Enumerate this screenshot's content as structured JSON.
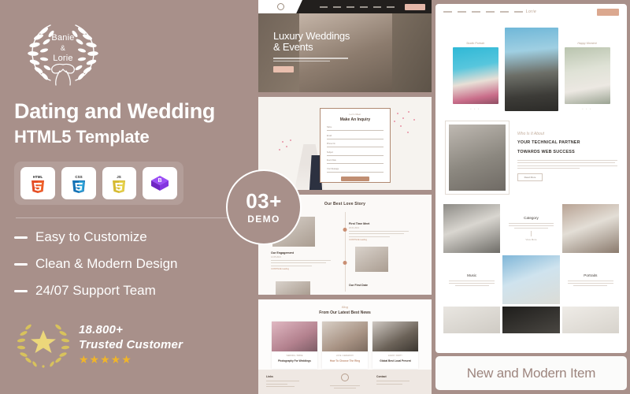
{
  "brand": {
    "logo_line1": "Banie",
    "logo_amp": "&",
    "logo_line2": "Lorie",
    "logo_icon": "laurel-wreath-icon"
  },
  "promo": {
    "headline": "Dating and Wedding",
    "subheadline": "HTML5 Template",
    "tech_badges": [
      {
        "name": "html5-icon",
        "label": "HTML5",
        "color": "#e44d26"
      },
      {
        "name": "css3-icon",
        "label": "CSS3",
        "color": "#1572b6"
      },
      {
        "name": "javascript-icon",
        "label": "JS",
        "color": "#d6ba32"
      },
      {
        "name": "bootstrap-icon",
        "label": "Bootstrap",
        "color": "#7b2ff7"
      }
    ],
    "features": [
      "Easy to Customize",
      "Clean & Modern Design",
      "24/07 Support Team"
    ],
    "trust": {
      "count": "18.800+",
      "label": "Trusted Customer",
      "stars": "★★★★★",
      "star_color": "#f0b429",
      "wreath_icon": "laurel-star-icon"
    }
  },
  "demo_badge": {
    "count": "03+",
    "label": "DEMO"
  },
  "previews": {
    "hero": {
      "title_line1": "Luxury Weddings",
      "title_line2": "& Events",
      "nav_items": [
        "Home",
        "About",
        "Service",
        "Blog",
        "Shop",
        "Contact"
      ],
      "cta_label": "Get A Quote"
    },
    "inquiry": {
      "eyebrow": "Let's Meet",
      "title": "Make An Inquiry",
      "fields": [
        "Name",
        "Email",
        "Phone No",
        "Subject",
        "Event Date",
        "Your Message"
      ],
      "submit_label": "Send Message"
    },
    "love_story": {
      "title": "Our Best Love Story",
      "events": [
        {
          "title": "First Time Meet",
          "date": "20.01.2021",
          "link": "CONTINUE reading"
        },
        {
          "title": "Our Engagement",
          "date": "12.05.2021",
          "link": "CONTINUE reading"
        },
        {
          "title": "Our First Date",
          "date": "08.08.2021",
          "link": "CONTINUE reading"
        }
      ]
    },
    "news": {
      "script": "Blog",
      "title": "From Our Latest Best News",
      "cards": [
        {
          "tag": "WEDDING / BRIDE",
          "title": "Photography For Weddings"
        },
        {
          "tag": "LOVE / CEREMONY",
          "title": "How To Choose The Ring"
        },
        {
          "tag": "EVENT / PARTY",
          "title": "Global Best Local Present"
        }
      ],
      "footer": {
        "links_title": "Links",
        "contact_title": "Contact",
        "logo_icon": "monogram-icon"
      }
    },
    "portfolio": {
      "nav_items": [
        "Home",
        "About",
        "Work",
        "Blog",
        "Shop",
        "Contact"
      ],
      "logo": "Lorie",
      "cta_label": "Contact Us",
      "gallery": [
        {
          "caption": "Studio Portrait",
          "dots": "• • •"
        },
        {
          "caption": "",
          "dots": ""
        },
        {
          "caption": "Happy Moment",
          "dots": "• • •"
        }
      ],
      "about": {
        "script": "Who Is It About",
        "heading_line1": "YOUR TECHNICAL PARTNER",
        "heading_line2": "TOWARDS WEB SUCCESS",
        "button_label": "Read More"
      },
      "categories": [
        {
          "title": "Category",
          "mini": "View More"
        },
        {
          "title": "Music",
          "mini": ""
        },
        {
          "title": "Portraits",
          "mini": ""
        }
      ]
    }
  },
  "banner": {
    "text": "New and Modern Item"
  },
  "colors": {
    "background": "#a8908a",
    "accent": "#c08e72",
    "gold": "#f0b429",
    "banner_text": "#9d857e"
  }
}
